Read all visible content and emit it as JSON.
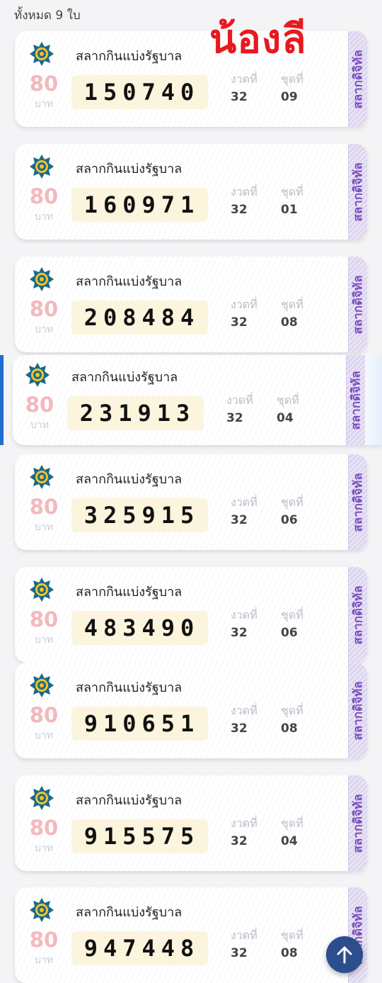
{
  "header": {
    "count_text": "ทั้งหมด 9 ใบ"
  },
  "overlay": {
    "owner_label": "น้องลี"
  },
  "labels": {
    "lottery_title": "สลากกินแบ่งรัฐบาล",
    "price": "80",
    "price_unit": "บาท",
    "draw_label": "งวดที่",
    "set_label": "ชุดที่",
    "stub_text": "สลากดิจิทัล"
  },
  "tickets": [
    {
      "number": "150740",
      "draw": "32",
      "set": "09"
    },
    {
      "number": "160971",
      "draw": "32",
      "set": "01"
    },
    {
      "number": "208484",
      "draw": "32",
      "set": "08"
    },
    {
      "number": "231913",
      "draw": "32",
      "set": "04"
    },
    {
      "number": "325915",
      "draw": "32",
      "set": "06"
    },
    {
      "number": "483490",
      "draw": "32",
      "set": "06"
    },
    {
      "number": "910651",
      "draw": "32",
      "set": "08"
    },
    {
      "number": "915575",
      "draw": "32",
      "set": "04"
    },
    {
      "number": "947448",
      "draw": "32",
      "set": "08"
    }
  ],
  "colors": {
    "owner_label": "#e8191f",
    "price": "#f3b8bd",
    "number_bg": "#fbf5dd",
    "stub_text": "#7a4fc0",
    "selection": "#1f6fd1",
    "scroll_button": "#2c4d8e"
  },
  "icons": {
    "emblem": "government-lottery-emblem-icon",
    "scroll_top": "arrow-up-icon"
  }
}
